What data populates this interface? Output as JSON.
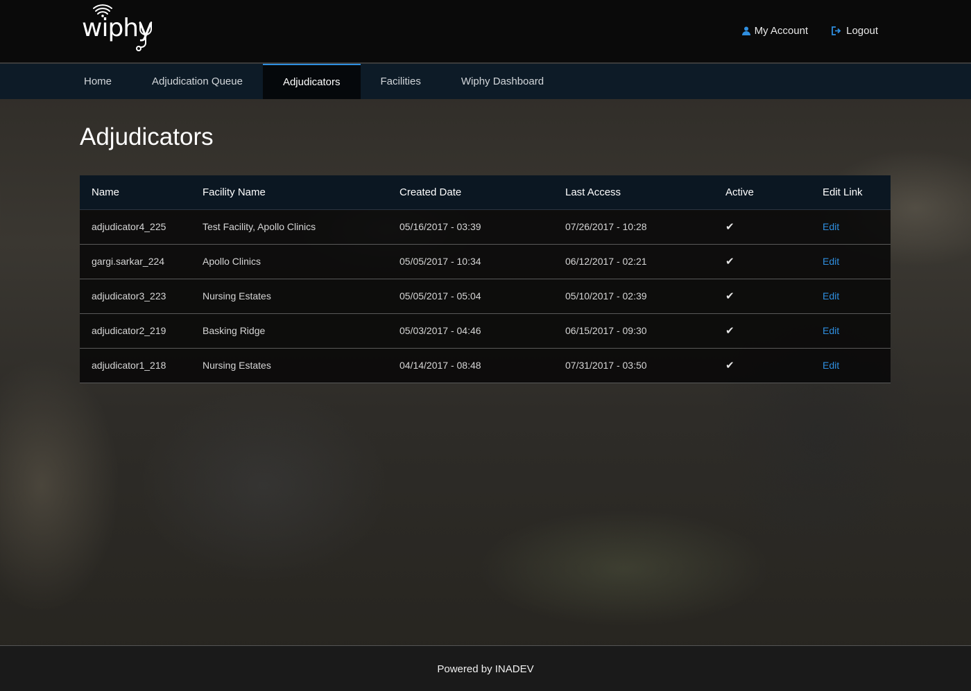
{
  "brand": {
    "logo_text": "wiphy"
  },
  "header": {
    "my_account_label": "My Account",
    "logout_label": "Logout",
    "accent_color": "#2f8fe0"
  },
  "nav": {
    "items": [
      {
        "label": "Home",
        "active": false
      },
      {
        "label": "Adjudication Queue",
        "active": false
      },
      {
        "label": "Adjudicators",
        "active": true
      },
      {
        "label": "Facilities",
        "active": false
      },
      {
        "label": "Wiphy Dashboard",
        "active": false
      }
    ]
  },
  "page": {
    "title": "Adjudicators"
  },
  "table": {
    "columns": [
      "Name",
      "Facility Name",
      "Created Date",
      "Last Access",
      "Active",
      "Edit Link"
    ],
    "rows": [
      {
        "name": "adjudicator4_225",
        "facility": "Test Facility, Apollo Clinics",
        "created": "05/16/2017 - 03:39",
        "last_access": "07/26/2017 - 10:28",
        "active": true,
        "edit": "Edit"
      },
      {
        "name": "gargi.sarkar_224",
        "facility": "Apollo Clinics",
        "created": "05/05/2017 - 10:34",
        "last_access": "06/12/2017 - 02:21",
        "active": true,
        "edit": "Edit"
      },
      {
        "name": "adjudicator3_223",
        "facility": "Nursing Estates",
        "created": "05/05/2017 - 05:04",
        "last_access": "05/10/2017 - 02:39",
        "active": true,
        "edit": "Edit"
      },
      {
        "name": "adjudicator2_219",
        "facility": "Basking Ridge",
        "created": "05/03/2017 - 04:46",
        "last_access": "06/15/2017 - 09:30",
        "active": true,
        "edit": "Edit"
      },
      {
        "name": "adjudicator1_218",
        "facility": "Nursing Estates",
        "created": "04/14/2017 - 08:48",
        "last_access": "07/31/2017 - 03:50",
        "active": true,
        "edit": "Edit"
      }
    ]
  },
  "footer": {
    "text": "Powered by INADEV"
  },
  "icons": {
    "account": "user-icon",
    "logout": "logout-icon",
    "active": "check-icon",
    "logo_wifi": "wifi-icon",
    "logo_stethoscope": "stethoscope-icon"
  }
}
